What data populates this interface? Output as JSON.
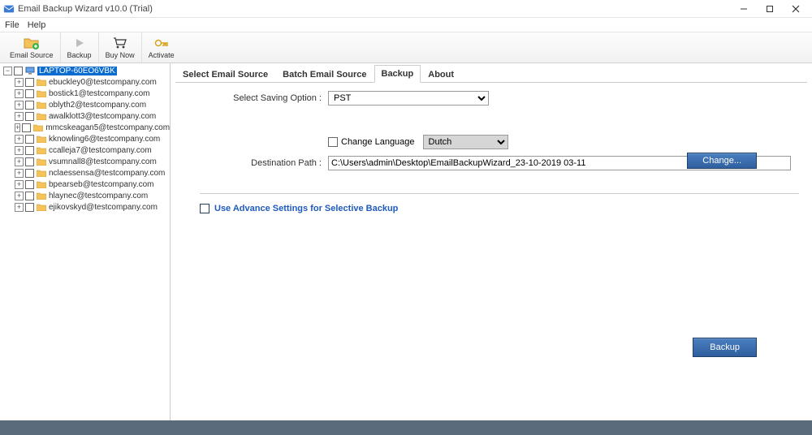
{
  "window": {
    "title": "Email Backup Wizard v10.0 (Trial)"
  },
  "menu": {
    "file": "File",
    "help": "Help"
  },
  "toolbar": {
    "emailSource": "Email Source",
    "backup": "Backup",
    "buyNow": "Buy Now",
    "activate": "Activate"
  },
  "tree": {
    "root": "LAPTOP-60EO6VBK",
    "items": [
      "ebuckley0@testcompany.com",
      "bostick1@testcompany.com",
      "oblyth2@testcompany.com",
      "awalklott3@testcompany.com",
      "mmcskeagan5@testcompany.com",
      "kknowling6@testcompany.com",
      "ccalleja7@testcompany.com",
      "vsumnall8@testcompany.com",
      "nclaessensa@testcompany.com",
      "bpearseb@testcompany.com",
      "hlaynec@testcompany.com",
      "ejikovskyd@testcompany.com"
    ]
  },
  "tabs": {
    "selectEmailSource": "Select Email Source",
    "batchEmailSource": "Batch Email Source",
    "backup": "Backup",
    "about": "About"
  },
  "form": {
    "savingOptionLabel": "Select Saving Option :",
    "savingOptionValue": "PST",
    "changeLanguageLabel": "Change Language",
    "languageValue": "Dutch",
    "destinationPathLabel": "Destination Path :",
    "destinationPathValue": "C:\\Users\\admin\\Desktop\\EmailBackupWizard_23-10-2019 03-11",
    "changeBtn": "Change...",
    "advanceLabel": "Use Advance Settings for Selective Backup",
    "backupBtn": "Backup"
  }
}
